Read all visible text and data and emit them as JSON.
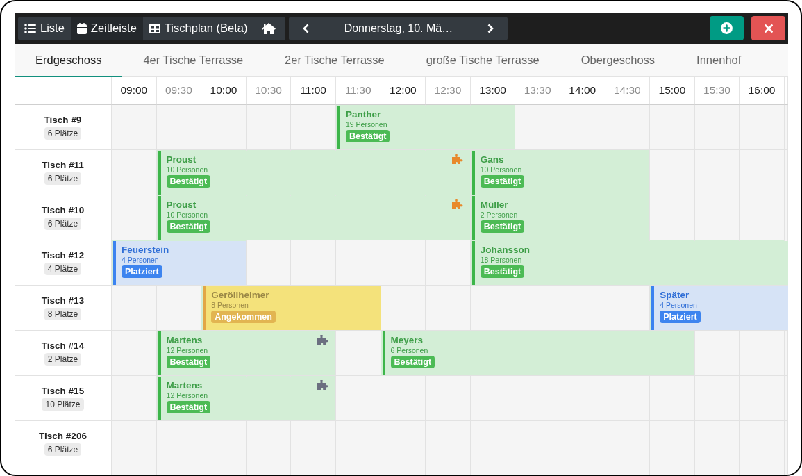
{
  "toolbar": {
    "views": [
      {
        "label": "Liste",
        "selected": false
      },
      {
        "label": "Zeitleiste",
        "selected": true
      },
      {
        "label": "Tischplan (Beta)",
        "selected": false
      }
    ],
    "date": "Donnerstag, 10. Mä…"
  },
  "floor_tabs": [
    {
      "label": "Erdgeschoss",
      "selected": true
    },
    {
      "label": "4er Tische Terrasse",
      "selected": false
    },
    {
      "label": "2er Tische Terrasse",
      "selected": false
    },
    {
      "label": "große Tische Terrasse",
      "selected": false
    },
    {
      "label": "Obergeschoss",
      "selected": false
    },
    {
      "label": "Innenhof",
      "selected": false
    }
  ],
  "timeline": {
    "times": [
      {
        "label": "09:00",
        "kind": "hour"
      },
      {
        "label": "09:30",
        "kind": "half"
      },
      {
        "label": "10:00",
        "kind": "hour"
      },
      {
        "label": "10:30",
        "kind": "half"
      },
      {
        "label": "11:00",
        "kind": "hour"
      },
      {
        "label": "11:30",
        "kind": "half"
      },
      {
        "label": "12:00",
        "kind": "hour"
      },
      {
        "label": "12:30",
        "kind": "half"
      },
      {
        "label": "13:00",
        "kind": "hour"
      },
      {
        "label": "13:30",
        "kind": "half"
      },
      {
        "label": "14:00",
        "kind": "hour"
      },
      {
        "label": "14:30",
        "kind": "half"
      },
      {
        "label": "15:00",
        "kind": "hour"
      },
      {
        "label": "15:30",
        "kind": "half"
      },
      {
        "label": "16:00",
        "kind": "hour"
      }
    ],
    "tables": [
      {
        "name": "Tisch #9",
        "seats": "6 Plätze",
        "cells": [
          {
            "occupied": false
          },
          {
            "occupied": false
          },
          {
            "occupied": false
          },
          {
            "occupied": false
          },
          {
            "occupied": false
          },
          {
            "occupied": true,
            "reservation": {
              "name": "Panther",
              "guests": "19 Personen",
              "kind": "confirmed",
              "status_label": "Bestätigt"
            }
          },
          {
            "occupied": true
          },
          {
            "occupied": true
          },
          {
            "occupied": true
          },
          {
            "occupied": false
          },
          {
            "occupied": false
          },
          {
            "occupied": false
          },
          {
            "occupied": false
          },
          {
            "occupied": false
          },
          {
            "occupied": false
          }
        ]
      },
      {
        "name": "Tisch #11",
        "seats": "6 Plätze",
        "cells": [
          {
            "occupied": false
          },
          {
            "occupied": true,
            "reservation": {
              "name": "Proust",
              "guests": "10 Personen",
              "kind": "confirmed",
              "status_label": "Bestätigt",
              "link": {
                "color": "#e8892b"
              }
            }
          },
          {
            "occupied": true
          },
          {
            "occupied": true
          },
          {
            "occupied": true
          },
          {
            "occupied": true
          },
          {
            "occupied": true
          },
          {
            "occupied": true
          },
          {
            "occupied": true,
            "reservation": {
              "name": "Gans",
              "guests": "10 Personen",
              "kind": "confirmed",
              "status_label": "Bestätigt"
            }
          },
          {
            "occupied": true
          },
          {
            "occupied": true
          },
          {
            "occupied": true
          },
          {
            "occupied": false
          },
          {
            "occupied": false
          },
          {
            "occupied": false
          }
        ]
      },
      {
        "name": "Tisch #10",
        "seats": "6 Plätze",
        "cells": [
          {
            "occupied": false
          },
          {
            "occupied": true,
            "reservation": {
              "name": "Proust",
              "guests": "10 Personen",
              "kind": "confirmed",
              "status_label": "Bestätigt",
              "link": {
                "color": "#e8892b"
              }
            }
          },
          {
            "occupied": true
          },
          {
            "occupied": true
          },
          {
            "occupied": true
          },
          {
            "occupied": true
          },
          {
            "occupied": true
          },
          {
            "occupied": true
          },
          {
            "occupied": true,
            "reservation": {
              "name": "Müller",
              "guests": "2 Personen",
              "kind": "confirmed",
              "status_label": "Bestätigt"
            }
          },
          {
            "occupied": true
          },
          {
            "occupied": true
          },
          {
            "occupied": true
          },
          {
            "occupied": false
          },
          {
            "occupied": false
          },
          {
            "occupied": false
          }
        ]
      },
      {
        "name": "Tisch #12",
        "seats": "4 Plätze",
        "cells": [
          {
            "occupied": true,
            "reservation": {
              "name": "Feuerstein",
              "guests": "4 Personen",
              "kind": "placed",
              "status_label": "Platziert"
            }
          },
          {
            "occupied": true
          },
          {
            "occupied": true
          },
          {
            "occupied": false
          },
          {
            "occupied": false
          },
          {
            "occupied": false
          },
          {
            "occupied": false
          },
          {
            "occupied": false
          },
          {
            "occupied": true,
            "reservation": {
              "name": "Johansson",
              "guests": "18 Personen",
              "kind": "confirmed",
              "status_label": "Bestätigt"
            }
          },
          {
            "occupied": true
          },
          {
            "occupied": true
          },
          {
            "occupied": true
          },
          {
            "occupied": true
          },
          {
            "occupied": true
          },
          {
            "occupied": true
          }
        ]
      },
      {
        "name": "Tisch #13",
        "seats": "8 Plätze",
        "cells": [
          {
            "occupied": false
          },
          {
            "occupied": false
          },
          {
            "occupied": true,
            "reservation": {
              "name": "Geröllheimer",
              "guests": "8 Personen",
              "kind": "arrived",
              "status_label": "Angekommen"
            }
          },
          {
            "occupied": true
          },
          {
            "occupied": true
          },
          {
            "occupied": true
          },
          {
            "occupied": false
          },
          {
            "occupied": false
          },
          {
            "occupied": false
          },
          {
            "occupied": false
          },
          {
            "occupied": false
          },
          {
            "occupied": false
          },
          {
            "occupied": true,
            "reservation": {
              "name": "Später",
              "guests": "4 Personen",
              "kind": "placed",
              "status_label": "Platziert"
            }
          },
          {
            "occupied": true
          },
          {
            "occupied": true
          }
        ]
      },
      {
        "name": "Tisch #14",
        "seats": "2 Plätze",
        "cells": [
          {
            "occupied": false
          },
          {
            "occupied": true,
            "reservation": {
              "name": "Martens",
              "guests": "12 Personen",
              "kind": "confirmed",
              "status_label": "Bestätigt",
              "link": {
                "color": "#6b6f80"
              }
            }
          },
          {
            "occupied": true
          },
          {
            "occupied": true
          },
          {
            "occupied": true
          },
          {
            "occupied": false
          },
          {
            "occupied": true,
            "reservation": {
              "name": "Meyers",
              "guests": "6 Personen",
              "kind": "confirmed",
              "status_label": "Bestätigt"
            }
          },
          {
            "occupied": true
          },
          {
            "occupied": true
          },
          {
            "occupied": true
          },
          {
            "occupied": true
          },
          {
            "occupied": true
          },
          {
            "occupied": true
          },
          {
            "occupied": false
          },
          {
            "occupied": false
          }
        ]
      },
      {
        "name": "Tisch #15",
        "seats": "10 Plätze",
        "cells": [
          {
            "occupied": false
          },
          {
            "occupied": true,
            "reservation": {
              "name": "Martens",
              "guests": "12 Personen",
              "kind": "confirmed",
              "status_label": "Bestätigt",
              "link": {
                "color": "#6b6f80"
              }
            }
          },
          {
            "occupied": true
          },
          {
            "occupied": true
          },
          {
            "occupied": true
          },
          {
            "occupied": false
          },
          {
            "occupied": false
          },
          {
            "occupied": false
          },
          {
            "occupied": false
          },
          {
            "occupied": false
          },
          {
            "occupied": false
          },
          {
            "occupied": false
          },
          {
            "occupied": false
          },
          {
            "occupied": false
          },
          {
            "occupied": false
          }
        ]
      },
      {
        "name": "Tisch #206",
        "seats": "6 Plätze",
        "cells": [
          {
            "occupied": false
          },
          {
            "occupied": false
          },
          {
            "occupied": false
          },
          {
            "occupied": false
          },
          {
            "occupied": false
          },
          {
            "occupied": false
          },
          {
            "occupied": false
          },
          {
            "occupied": false
          },
          {
            "occupied": false
          },
          {
            "occupied": false
          },
          {
            "occupied": false
          },
          {
            "occupied": false
          },
          {
            "occupied": false
          },
          {
            "occupied": false
          },
          {
            "occupied": false
          }
        ]
      }
    ]
  }
}
